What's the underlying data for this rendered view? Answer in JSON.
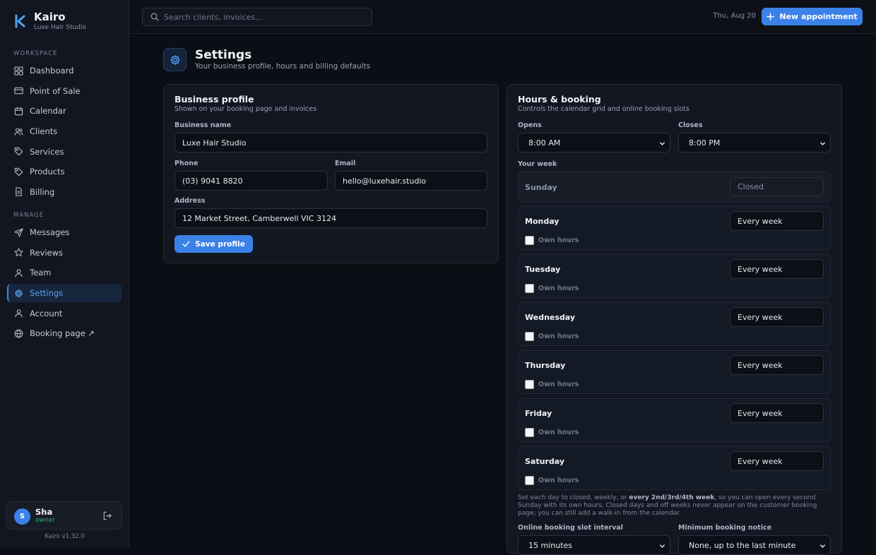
{
  "brand": {
    "name": "Kairo",
    "subtitle": "Luxe Hair Studio"
  },
  "sidebar": {
    "workspace_label": "WORKSPACE",
    "workspace_items": [
      {
        "label": "Dashboard",
        "icon": "dashboard-icon"
      },
      {
        "label": "Point of Sale",
        "icon": "card-icon"
      },
      {
        "label": "Calendar",
        "icon": "calendar-icon"
      },
      {
        "label": "Clients",
        "icon": "users-icon"
      },
      {
        "label": "Services",
        "icon": "tag-icon"
      },
      {
        "label": "Products",
        "icon": "tag-icon"
      },
      {
        "label": "Billing",
        "icon": "document-icon"
      }
    ],
    "manage_label": "MANAGE",
    "manage_items": [
      {
        "label": "Messages",
        "icon": "send-icon"
      },
      {
        "label": "Reviews",
        "icon": "star-icon"
      },
      {
        "label": "Team",
        "icon": "user-icon"
      },
      {
        "label": "Settings",
        "icon": "gear-icon",
        "active": true
      },
      {
        "label": "Account",
        "icon": "user-icon"
      },
      {
        "label": "Booking page ↗",
        "icon": "globe-icon"
      }
    ],
    "user": {
      "initial": "S",
      "name": "Sha",
      "role": "owner"
    },
    "version": "Kairo v1.32.0"
  },
  "topbar": {
    "search_placeholder": "Search clients, invoices...",
    "date": "Thu, Aug 20",
    "new_appointment_label": "New appointment"
  },
  "page": {
    "title": "Settings",
    "subtitle": "Your business profile, hours and billing defaults"
  },
  "business_profile": {
    "title": "Business profile",
    "subtitle": "Shown on your booking page and invoices",
    "name_label": "Business name",
    "name_value": "Luxe Hair Studio",
    "phone_label": "Phone",
    "phone_value": "(03) 9041 8820",
    "email_label": "Email",
    "email_value": "hello@luxehair.studio",
    "address_label": "Address",
    "address_value": "12 Market Street, Camberwell VIC 3124",
    "save_label": "Save profile"
  },
  "hours": {
    "title": "Hours & booking",
    "subtitle": "Controls the calendar grid and online booking slots",
    "opens_label": "Opens",
    "opens_value": "8:00 AM",
    "closes_label": "Closes",
    "closes_value": "8:00 PM",
    "week_label": "Your week",
    "days": [
      {
        "name": "Sunday",
        "schedule": "Closed",
        "closed": true
      },
      {
        "name": "Monday",
        "schedule": "Every week",
        "own_hours": "Own hours"
      },
      {
        "name": "Tuesday",
        "schedule": "Every week",
        "own_hours": "Own hours"
      },
      {
        "name": "Wednesday",
        "schedule": "Every week",
        "own_hours": "Own hours"
      },
      {
        "name": "Thursday",
        "schedule": "Every week",
        "own_hours": "Own hours"
      },
      {
        "name": "Friday",
        "schedule": "Every week",
        "own_hours": "Own hours"
      },
      {
        "name": "Saturday",
        "schedule": "Every week",
        "own_hours": "Own hours"
      }
    ],
    "help_pre": "Set each day to closed, weekly, or ",
    "help_bold": "every 2nd/3rd/4th week",
    "help_post": ", so you can open every second Sunday with its own hours. Closed days and off weeks never appear on the customer booking page; you can still add a walk-in from the calendar.",
    "slot_label": "Online booking slot interval",
    "slot_value": "15 minutes",
    "notice_label": "Minimum booking notice",
    "notice_value": "None, up to the last minute"
  },
  "colors": {
    "accent": "#3b82e8",
    "active_text": "#5aa2f0",
    "role_green": "#2fb36b"
  }
}
